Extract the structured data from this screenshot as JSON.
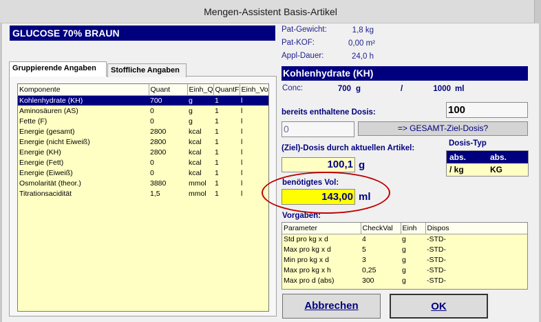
{
  "window": {
    "title": "Mengen-Assistent Basis-Artikel"
  },
  "article": {
    "name": "GLUCOSE 70% BRAUN"
  },
  "tabs": [
    {
      "label": "Gruppierende Angaben",
      "active": true
    },
    {
      "label": "Stoffliche Angaben",
      "active": false
    }
  ],
  "components": {
    "columns": [
      "Komponente",
      "Quant",
      "Einh_Q",
      "QuantF",
      "Einh_Vo"
    ],
    "rows": [
      [
        "Kohlenhydrate (KH)",
        "700",
        "g",
        "1",
        "l"
      ],
      [
        "Aminosäuren (AS)",
        "0",
        "g",
        "1",
        "l"
      ],
      [
        "Fette (F)",
        "0",
        "g",
        "1",
        "l"
      ],
      [
        "Energie (gesamt)",
        "2800",
        "kcal",
        "1",
        "l"
      ],
      [
        "Energie (nicht Eiweiß)",
        "2800",
        "kcal",
        "1",
        "l"
      ],
      [
        "Energie (KH)",
        "2800",
        "kcal",
        "1",
        "l"
      ],
      [
        "Energie (Fett)",
        "0",
        "kcal",
        "1",
        "l"
      ],
      [
        "Energie (Eiweiß)",
        "0",
        "kcal",
        "1",
        "l"
      ],
      [
        "Osmolarität (theor.)",
        "3880",
        "mmol",
        "1",
        "l"
      ],
      [
        "Titrationsacidität",
        "1,5",
        "mmol",
        "1",
        "l"
      ]
    ],
    "selected_row": 0
  },
  "patient": {
    "weight_label": "Pat-Gewicht:",
    "weight_value": "1,8 kg",
    "kof_label": "Pat-KOF:",
    "kof_value": "0,00 m²",
    "duration_label": "Appl-Dauer:",
    "duration_value": "24,0 h"
  },
  "substance": {
    "title": "Kohlenhydrate (KH)",
    "conc_label": "Conc:",
    "conc_amount": "700",
    "conc_amount_unit": "g",
    "conc_sep": "/",
    "conc_volume": "1000",
    "conc_volume_unit": "ml"
  },
  "dose": {
    "contained_label": "bereits enthaltene Dosis:",
    "contained_value": "0",
    "target_total": "100",
    "gesamt_button": "=> GESAMT-Ziel-Dosis?",
    "ziel_label": "(Ziel)-Dosis durch aktuellen Artikel:",
    "ziel_value": "100,1",
    "ziel_unit": "g",
    "vol_label": "benötigtes Vol:",
    "vol_value": "143,00",
    "vol_unit": "ml"
  },
  "dosis_typ": {
    "label": "Dosis-Typ",
    "rows": [
      [
        "abs.",
        "abs."
      ],
      [
        "/ kg",
        "KG"
      ]
    ],
    "selected_row": 0
  },
  "vorgaben": {
    "label": "Vorgaben:",
    "columns": [
      "Parameter",
      "CheckVal",
      "Einh",
      "Dispos"
    ],
    "rows": [
      [
        "Std pro kg x d",
        "4",
        "g",
        "-STD-"
      ],
      [
        "Max pro kg x d",
        "5",
        "g",
        "-STD-"
      ],
      [
        "Min pro kg x d",
        "3",
        "g",
        "-STD-"
      ],
      [
        "Max pro kg x h",
        "0,25",
        "g",
        "-STD-"
      ],
      [
        "Max pro d (abs)",
        "300",
        "g",
        "-STD-"
      ]
    ]
  },
  "buttons": {
    "cancel": "Abbrechen",
    "ok": "OK"
  },
  "colors": {
    "header_blue": "#00007f",
    "table_yellow": "#ffffc4",
    "highlight_yellow": "#ffff00",
    "annotation_red": "#c00000"
  }
}
